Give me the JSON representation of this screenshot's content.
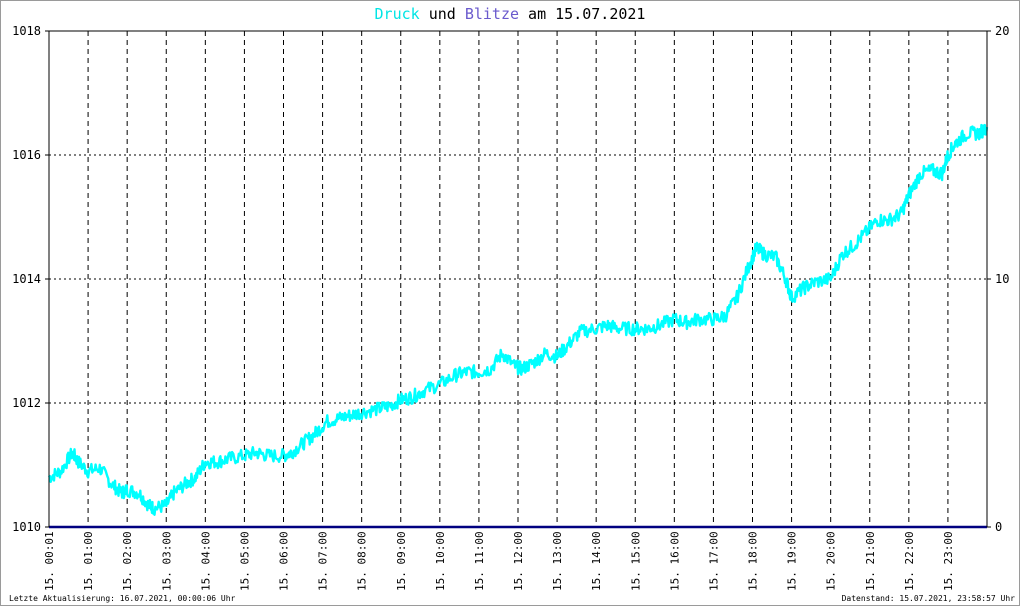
{
  "title": {
    "part1": "Druck",
    "part2": " und ",
    "part3": "Blitze",
    "part4": " am 15.07.2021",
    "color1": "#00e5e5",
    "color2": "#000000",
    "color3": "#6a5acd"
  },
  "footer": {
    "left": "Letzte Aktualisierung: 16.07.2021, 00:00:06 Uhr",
    "right": "Datenstand: 15.07.2021, 23:58:57 Uhr"
  },
  "colors": {
    "pressure": "#00ffff",
    "lightning": "#000080",
    "grid": "#000000"
  },
  "chart_data": {
    "type": "line",
    "title": "Druck und Blitze am 15.07.2021",
    "xlabel": "",
    "ylabel": "",
    "xlim": [
      0,
      24
    ],
    "ylim": [
      1010,
      1018
    ],
    "y2lim": [
      0,
      20
    ],
    "y_ticks": [
      "1010",
      "1012",
      "1014",
      "1016",
      "1018"
    ],
    "y2_ticks": [
      "0",
      "10",
      "20"
    ],
    "x_tick_labels": [
      "15. 00:01",
      "15. 01:00",
      "15. 02:00",
      "15. 03:00",
      "15. 04:00",
      "15. 05:00",
      "15. 06:00",
      "15. 07:00",
      "15. 08:00",
      "15. 09:00",
      "15. 10:00",
      "15. 11:00",
      "15. 12:00",
      "15. 13:00",
      "15. 14:00",
      "15. 15:00",
      "15. 16:00",
      "15. 17:00",
      "15. 18:00",
      "15. 19:00",
      "15. 20:00",
      "15. 21:00",
      "15. 22:00",
      "15. 23:00"
    ],
    "grid": true,
    "series": [
      {
        "name": "Druck",
        "axis": "left",
        "x": [
          0.0,
          0.3,
          0.6,
          0.75,
          1.0,
          1.3,
          1.6,
          1.85,
          2.0,
          2.3,
          2.55,
          2.7,
          3.0,
          3.2,
          3.5,
          3.75,
          4.0,
          4.3,
          4.6,
          5.0,
          5.3,
          5.6,
          6.0,
          6.2,
          6.5,
          6.8,
          7.1,
          7.4,
          7.7,
          8.0,
          8.4,
          8.7,
          9.0,
          9.3,
          9.6,
          10.0,
          10.4,
          10.7,
          11.0,
          11.3,
          11.6,
          11.9,
          12.1,
          12.4,
          12.7,
          13.0,
          13.3,
          13.6,
          14.0,
          14.3,
          14.6,
          15.0,
          15.3,
          15.6,
          16.0,
          16.3,
          16.6,
          17.0,
          17.3,
          17.6,
          17.9,
          18.1,
          18.3,
          18.6,
          18.85,
          19.0,
          19.3,
          19.6,
          20.0,
          20.3,
          20.6,
          20.9,
          21.2,
          21.5,
          21.8,
          22.0,
          22.3,
          22.6,
          22.85,
          23.0,
          23.2,
          23.5,
          23.8,
          24.0
        ],
        "values": [
          1010.8,
          1010.9,
          1011.2,
          1011.05,
          1010.9,
          1010.95,
          1010.7,
          1010.55,
          1010.6,
          1010.55,
          1010.35,
          1010.3,
          1010.35,
          1010.55,
          1010.7,
          1010.8,
          1011.05,
          1011.05,
          1011.1,
          1011.15,
          1011.2,
          1011.15,
          1011.15,
          1011.2,
          1011.35,
          1011.5,
          1011.7,
          1011.75,
          1011.8,
          1011.85,
          1011.9,
          1011.95,
          1012.05,
          1012.1,
          1012.2,
          1012.3,
          1012.45,
          1012.5,
          1012.5,
          1012.55,
          1012.8,
          1012.6,
          1012.55,
          1012.65,
          1012.8,
          1012.75,
          1012.95,
          1013.15,
          1013.2,
          1013.25,
          1013.2,
          1013.2,
          1013.2,
          1013.25,
          1013.35,
          1013.3,
          1013.35,
          1013.35,
          1013.4,
          1013.7,
          1014.2,
          1014.5,
          1014.4,
          1014.35,
          1014.0,
          1013.7,
          1013.85,
          1013.95,
          1014.0,
          1014.4,
          1014.55,
          1014.75,
          1014.95,
          1014.95,
          1015.05,
          1015.35,
          1015.7,
          1015.75,
          1015.7,
          1016.0,
          1016.2,
          1016.35,
          1016.35,
          1016.45
        ]
      },
      {
        "name": "Blitze",
        "axis": "right",
        "x": [
          0,
          24
        ],
        "values": [
          0,
          0
        ]
      }
    ]
  }
}
